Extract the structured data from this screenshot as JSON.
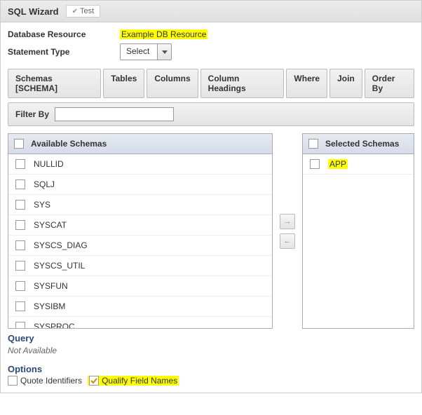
{
  "header": {
    "title": "SQL Wizard",
    "test_label": "Test"
  },
  "form": {
    "db_label": "Database Resource",
    "db_value": "Example DB Resource",
    "stmt_label": "Statement Type",
    "stmt_value": "Select"
  },
  "tabs": {
    "schemas": "Schemas [SCHEMA]",
    "tables": "Tables",
    "columns": "Columns",
    "headings": "Column Headings",
    "where": "Where",
    "join": "Join",
    "orderby": "Order By"
  },
  "filter": {
    "label": "Filter By",
    "value": ""
  },
  "available": {
    "title": "Available Schemas",
    "items": [
      "NULLID",
      "SQLJ",
      "SYS",
      "SYSCAT",
      "SYSCS_DIAG",
      "SYSCS_UTIL",
      "SYSFUN",
      "SYSIBM",
      "SYSPROC"
    ]
  },
  "selected": {
    "title": "Selected Schemas",
    "items": [
      "APP"
    ]
  },
  "query": {
    "label": "Query",
    "value": "Not Available"
  },
  "options": {
    "label": "Options",
    "quote": {
      "label": "Quote Identifiers",
      "checked": false
    },
    "qualify": {
      "label": "Qualify Field Names",
      "checked": true
    }
  }
}
